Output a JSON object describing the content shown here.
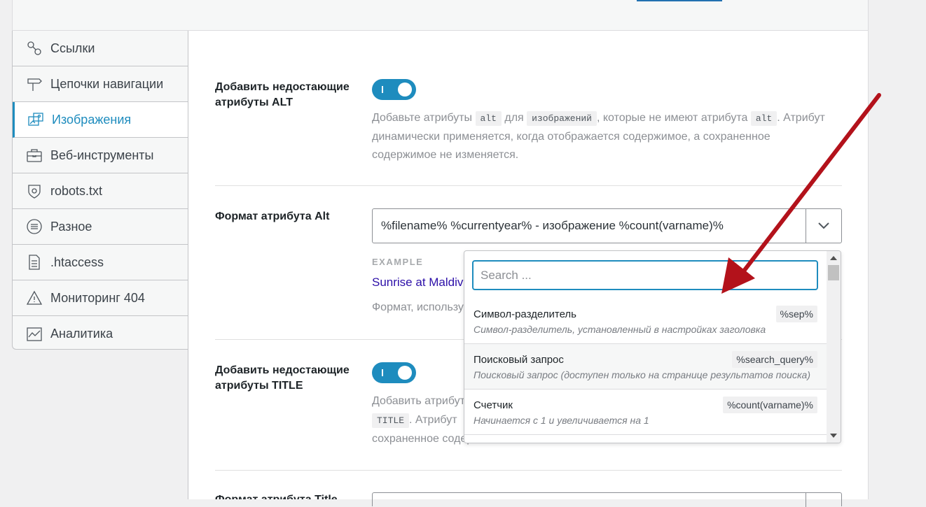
{
  "sidebar": {
    "items": [
      {
        "label": "Ссылки",
        "icon": "link-icon"
      },
      {
        "label": "Цепочки навигации",
        "icon": "signpost-icon"
      },
      {
        "label": "Изображения",
        "icon": "images-icon",
        "active": true
      },
      {
        "label": "Веб-инструменты",
        "icon": "briefcase-icon"
      },
      {
        "label": "robots.txt",
        "icon": "shield-icon"
      },
      {
        "label": "Разное",
        "icon": "list-circle-icon"
      },
      {
        "label": ".htaccess",
        "icon": "file-icon"
      },
      {
        "label": "Мониторинг 404",
        "icon": "warning-icon"
      },
      {
        "label": "Аналитика",
        "icon": "chart-icon"
      }
    ]
  },
  "settings": {
    "alt_missing": {
      "label": "Добавить недостающие атрибуты ALT",
      "enabled": true,
      "desc_1": "Добавьте атрибуты",
      "code_alt": "alt",
      "desc_2": "для",
      "code_images": "изображений",
      "desc_3": ", которые не имеют атрибута",
      "code_alt2": "alt",
      "desc_4": ". Атрибут динамически применяется, когда отображается содержимое, а сохраненное содержимое не изменяется."
    },
    "alt_format": {
      "label": "Формат атрибута Alt",
      "value": "%filename% %currentyear% - изображение %count(varname)%",
      "example_label": "EXAMPLE",
      "example_value": "Sunrise at Maldives",
      "note": "Формат, используемый"
    },
    "title_missing": {
      "label": "Добавить недостающие атрибуты TITLE",
      "enabled": true,
      "desc_1": "Добавить атрибуты",
      "code_title": "TITLE",
      "desc_2": ". Атрибут",
      "desc_3": "сохраненное содержимое"
    },
    "title_format": {
      "label": "Формат атрибута Title"
    }
  },
  "dropdown": {
    "search_placeholder": "Search ...",
    "items": [
      {
        "title": "Символ-разделитель",
        "var": "%sep%",
        "desc": "Символ-разделитель, установленный в настройках заголовка"
      },
      {
        "title": "Поисковый запрос",
        "var": "%search_query%",
        "desc": "Поисковый запрос (доступен только на странице результатов поиска)"
      },
      {
        "title": "Счетчик",
        "var": "%count(varname)%",
        "desc": "Начинается с 1 и увеличивается на 1"
      }
    ]
  },
  "colors": {
    "accent": "#1e8cbe",
    "annotation_arrow": "#b3121b"
  }
}
